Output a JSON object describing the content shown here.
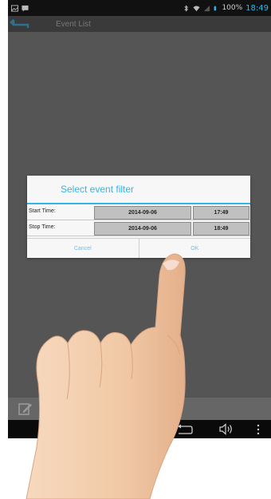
{
  "status_bar": {
    "left_icons": [
      "image-icon",
      "message-icon"
    ],
    "right_icons": [
      "bluetooth-icon",
      "wifi-icon",
      "signal-icon",
      "battery-icon"
    ],
    "battery_percent": "100%",
    "time": "18:49",
    "accent_color": "#33b5e5"
  },
  "action_bar": {
    "back_icon": "back-arrow-icon",
    "title": "Event List"
  },
  "dialog": {
    "title": "Select event filter",
    "rows": [
      {
        "label": "Start Time:",
        "date": "2014-09-06",
        "time": "17:49"
      },
      {
        "label": "Stop Time:",
        "date": "2014-09-06",
        "time": "18:49"
      }
    ],
    "cancel_label": "Cancel",
    "ok_label": "OK"
  },
  "bottom_toolbar": {
    "icon": "edit-icon"
  },
  "nav_bar": {
    "icons": [
      "back-icon",
      "volume-icon",
      "menu-icon"
    ]
  }
}
